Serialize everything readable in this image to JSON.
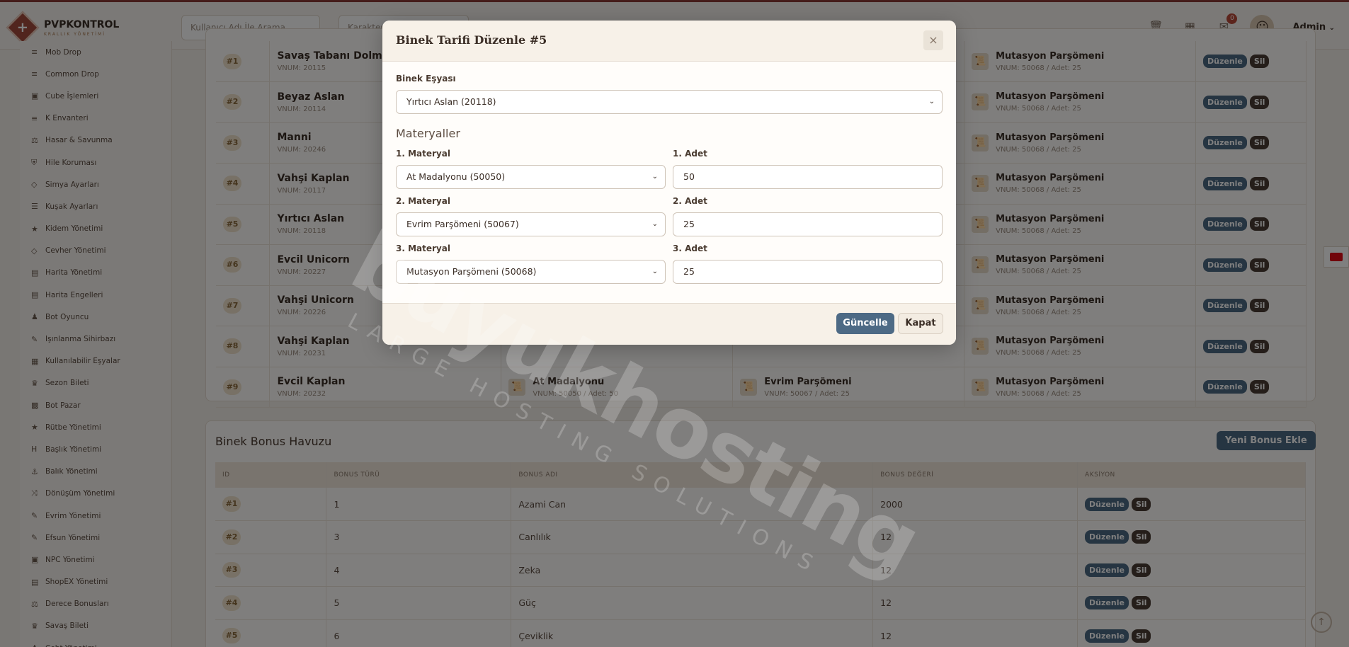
{
  "brand": {
    "name": "PVPKONTROL",
    "subtitle": "KRALLIK YÖNETİMİ"
  },
  "topbar": {
    "search_user_placeholder": "Kullanıcı Adı İle Arama",
    "search_char_placeholder": "Karakter",
    "mail_badge": "0",
    "admin_label": "Admin"
  },
  "sidebar": {
    "items": [
      {
        "icon": "≡",
        "label": "Mob Drop"
      },
      {
        "icon": "≡",
        "label": "Common Drop"
      },
      {
        "icon": "▣",
        "label": "Cube İşlemleri"
      },
      {
        "icon": "≡",
        "label": "K Envanteri"
      },
      {
        "icon": "⚖",
        "label": "Hasar & Savunma"
      },
      {
        "icon": "⛨",
        "label": "Hile Koruması"
      },
      {
        "icon": "◇",
        "label": "Simya Ayarları"
      },
      {
        "icon": "☰",
        "label": "Kuşak Ayarları"
      },
      {
        "icon": "★",
        "label": "Kidem Yönetimi"
      },
      {
        "icon": "◇",
        "label": "Cevher Yönetimi"
      },
      {
        "icon": "▤",
        "label": "Harita Yönetimi"
      },
      {
        "icon": "▤",
        "label": "Harita Engelleri"
      },
      {
        "icon": "♟",
        "label": "Bot Oyuncu"
      },
      {
        "icon": "✎",
        "label": "Işınlanma Sihirbazı"
      },
      {
        "icon": "▦",
        "label": "Kullanılabilir Eşyalar"
      },
      {
        "icon": "♛",
        "label": "Sezon Bileti"
      },
      {
        "icon": "▩",
        "label": "Bot Pazar"
      },
      {
        "icon": "★",
        "label": "Rütbe Yönetimi"
      },
      {
        "icon": "H",
        "label": "Başlık Yönetimi"
      },
      {
        "icon": "⚓",
        "label": "Balık Yönetimi"
      },
      {
        "icon": "⤨",
        "label": "Dönüşüm Yönetimi"
      },
      {
        "icon": "✎",
        "label": "Evrim Yönetimi"
      },
      {
        "icon": "✎",
        "label": "Efsun Yönetimi"
      },
      {
        "icon": "▣",
        "label": "NPC Yönetimi"
      },
      {
        "icon": "▤",
        "label": "ShopEX Yönetimi"
      },
      {
        "icon": "⚖",
        "label": "Derece Bonusları"
      },
      {
        "icon": "♛",
        "label": "Savaş Bileti"
      },
      {
        "icon": "♟",
        "label": "Ceht Yönetimi"
      }
    ]
  },
  "recipes": {
    "rows": [
      {
        "id": "#1",
        "name": "Savaş Tabanı Dolmuzu",
        "vnum": "VNUM: 20115",
        "m3_name": "Mutasyon Parşömeni",
        "m3_meta": "VNUM: 50068 / Adet: 25"
      },
      {
        "id": "#2",
        "name": "Beyaz Aslan",
        "vnum": "VNUM: 20114",
        "m3_name": "Mutasyon Parşömeni",
        "m3_meta": "VNUM: 50068 / Adet: 25"
      },
      {
        "id": "#3",
        "name": "Manni",
        "vnum": "VNUM: 20246",
        "m3_name": "Mutasyon Parşömeni",
        "m3_meta": "VNUM: 50068 / Adet: 25"
      },
      {
        "id": "#4",
        "name": "Vahşi Kaplan",
        "vnum": "VNUM: 20117",
        "m3_name": "Mutasyon Parşömeni",
        "m3_meta": "VNUM: 50068 / Adet: 25"
      },
      {
        "id": "#5",
        "name": "Yırtıcı Aslan",
        "vnum": "VNUM: 20118",
        "m3_name": "Mutasyon Parşömeni",
        "m3_meta": "VNUM: 50068 / Adet: 25"
      },
      {
        "id": "#6",
        "name": "Evcil Unicorn",
        "vnum": "VNUM: 20227",
        "m3_name": "Mutasyon Parşömeni",
        "m3_meta": "VNUM: 50068 / Adet: 25"
      },
      {
        "id": "#7",
        "name": "Vahşi Unicorn",
        "vnum": "VNUM: 20226",
        "m3_name": "Mutasyon Parşömeni",
        "m3_meta": "VNUM: 50068 / Adet: 25"
      },
      {
        "id": "#8",
        "name": "Vahşi Kaplan",
        "vnum": "VNUM: 20231",
        "m3_name": "Mutasyon Parşömeni",
        "m3_meta": "VNUM: 50068 / Adet: 25"
      },
      {
        "id": "#9",
        "name": "Evcil Kaplan",
        "vnum": "VNUM: 20232",
        "m1_name": "At Madalyonu",
        "m1_meta": "VNUM: 50050 / Adet: 50",
        "m2_name": "Evrim Parşömeni",
        "m2_meta": "VNUM: 50067 / Adet: 25",
        "m3_name": "Mutasyon Parşömeni",
        "m3_meta": "VNUM: 50068 / Adet: 25"
      }
    ],
    "edit_label": "Düzenle",
    "delete_label": "Sil"
  },
  "bonus_pool": {
    "title": "Binek Bonus Havuzu",
    "new_button": "Yeni Bonus Ekle",
    "headers": [
      "ID",
      "BONUS TÜRÜ",
      "BONUS ADI",
      "BONUS DEĞERİ",
      "AKSİYON"
    ],
    "rows": [
      {
        "id": "#1",
        "type": "1",
        "name": "Azami Can",
        "value": "2000"
      },
      {
        "id": "#2",
        "type": "3",
        "name": "Canlılık",
        "value": "12"
      },
      {
        "id": "#3",
        "type": "4",
        "name": "Zeka",
        "value": "12"
      },
      {
        "id": "#4",
        "type": "5",
        "name": "Güç",
        "value": "12"
      },
      {
        "id": "#5",
        "type": "6",
        "name": "Çeviklik",
        "value": "12"
      }
    ]
  },
  "watermark": {
    "main": "buyukhosting",
    "sub": "LARGE HOSTING SOLUTIONS"
  },
  "modal": {
    "title": "Binek Tarifi Düzenle #5",
    "close_icon": "×",
    "mount_label": "Binek Eşyası",
    "mount_value": "Yırtıcı Aslan (20118)",
    "materials_title": "Materyaller",
    "materials": [
      {
        "label": "1. Materyal",
        "value": "At Madalyonu (50050)",
        "qty_label": "1. Adet",
        "qty": "50"
      },
      {
        "label": "2. Materyal",
        "value": "Evrim Parşömeni (50067)",
        "qty_label": "2. Adet",
        "qty": "25"
      },
      {
        "label": "3. Materyal",
        "value": "Mutasyon Parşömeni (50068)",
        "qty_label": "3. Adet",
        "qty": "25"
      }
    ],
    "save_button": "Güncelle",
    "close_button": "Kapat"
  }
}
